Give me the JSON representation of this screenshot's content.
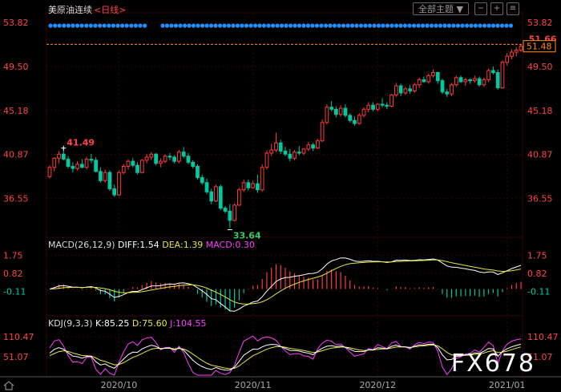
{
  "header": {
    "instrument": "美原油连续",
    "period": "<日线>",
    "theme_button": "全部主题 ▼",
    "brand_color": "#ff4444"
  },
  "indicators": {
    "macd": {
      "name": "MACD(26,12,9)",
      "diff": "DIFF:1.54",
      "dea": "DEA:1.39",
      "macd": "MACD:0.30"
    },
    "kdj": {
      "name": "KDJ(9,3,3)",
      "k": "K:85.25",
      "d": "D:75.60",
      "j": "J:104.55"
    }
  },
  "watermark": "FX678",
  "price_label": "51.48",
  "chart_data": {
    "type": "candlestick",
    "price_axis": {
      "ticks": [
        53.82,
        49.5,
        45.18,
        40.87,
        36.55
      ],
      "labels": [
        "53.82",
        "49.50",
        "45.18",
        "40.87",
        "36.55"
      ],
      "ylim": [
        32.9,
        54.6
      ]
    },
    "macd_axis": {
      "ticks": [
        1.75,
        0.82,
        -0.11
      ],
      "labels": [
        "1.75",
        "0.82",
        "-0.11"
      ],
      "ylim": [
        -1.3,
        2.1
      ]
    },
    "kdj_axis": {
      "ticks": [
        110.47,
        51.07
      ],
      "labels": [
        "110.47",
        "51.07"
      ],
      "ylim": [
        -5,
        140
      ]
    },
    "x_labels": [
      "2020/10",
      "2020/11",
      "2020/12",
      "2021/01"
    ],
    "x_label_index": [
      15,
      44,
      71,
      99
    ],
    "annotations": [
      {
        "text": "41.49",
        "index": 3,
        "value": 41.49
      },
      {
        "text": "33.64",
        "index": 39,
        "value": 33.64
      },
      {
        "text": "51.66",
        "index": 103,
        "value": 51.66
      }
    ],
    "last_close": 51.48,
    "max_line": 51.66,
    "colors": {
      "up": "#ff3b3b",
      "down": "#00c8a0",
      "diff": "#ffffff",
      "dea": "#e6e63c",
      "j": "#ff3cff"
    },
    "candles": [
      [
        38.7,
        39.8,
        38.5,
        39.6
      ],
      [
        39.6,
        40.6,
        39.2,
        40.5
      ],
      [
        40.5,
        41.2,
        40.0,
        40.9
      ],
      [
        40.9,
        41.49,
        40.3,
        40.4
      ],
      [
        40.4,
        40.7,
        39.5,
        39.7
      ],
      [
        39.7,
        40.1,
        39.1,
        39.5
      ],
      [
        39.5,
        40.2,
        39.3,
        39.9
      ],
      [
        39.9,
        40.4,
        39.5,
        39.6
      ],
      [
        39.6,
        40.6,
        39.4,
        40.4
      ],
      [
        40.4,
        40.9,
        40.0,
        40.3
      ],
      [
        40.3,
        40.6,
        39.1,
        39.2
      ],
      [
        39.2,
        39.6,
        38.1,
        38.3
      ],
      [
        38.3,
        39.4,
        38.1,
        39.1
      ],
      [
        39.1,
        39.3,
        37.3,
        37.5
      ],
      [
        37.5,
        37.9,
        36.7,
        36.9
      ],
      [
        36.9,
        39.3,
        36.8,
        39.1
      ],
      [
        39.1,
        39.9,
        38.9,
        39.7
      ],
      [
        39.7,
        40.4,
        39.4,
        40.2
      ],
      [
        40.2,
        40.5,
        39.6,
        39.8
      ],
      [
        39.8,
        40.1,
        38.9,
        39.1
      ],
      [
        39.1,
        40.4,
        39.0,
        40.3
      ],
      [
        40.3,
        40.9,
        40.0,
        40.6
      ],
      [
        40.6,
        41.1,
        40.3,
        40.9
      ],
      [
        40.9,
        41.0,
        39.8,
        40.0
      ],
      [
        40.0,
        40.5,
        39.6,
        40.2
      ],
      [
        40.2,
        40.9,
        40.0,
        40.7
      ],
      [
        40.7,
        41.0,
        40.3,
        40.6
      ],
      [
        40.6,
        40.8,
        40.0,
        40.2
      ],
      [
        40.2,
        41.3,
        40.0,
        41.1
      ],
      [
        41.1,
        41.6,
        40.5,
        40.7
      ],
      [
        40.7,
        41.0,
        39.9,
        40.1
      ],
      [
        40.1,
        40.3,
        39.5,
        39.7
      ],
      [
        39.7,
        39.9,
        38.4,
        38.6
      ],
      [
        38.6,
        38.9,
        37.9,
        38.1
      ],
      [
        38.1,
        38.5,
        37.0,
        37.2
      ],
      [
        37.2,
        37.5,
        36.0,
        36.3
      ],
      [
        36.3,
        37.9,
        36.2,
        37.7
      ],
      [
        37.7,
        37.9,
        35.4,
        35.6
      ],
      [
        35.6,
        35.8,
        35.1,
        35.3
      ],
      [
        35.3,
        36.0,
        33.64,
        34.4
      ],
      [
        34.4,
        36.1,
        34.3,
        35.9
      ],
      [
        35.9,
        37.6,
        35.8,
        37.4
      ],
      [
        37.4,
        38.4,
        37.2,
        38.1
      ],
      [
        38.1,
        38.4,
        37.3,
        37.6
      ],
      [
        37.6,
        38.3,
        37.5,
        38.0
      ],
      [
        38.0,
        38.9,
        37.1,
        37.4
      ],
      [
        37.4,
        39.9,
        37.2,
        39.6
      ],
      [
        39.6,
        41.3,
        39.4,
        41.0
      ],
      [
        41.0,
        41.9,
        40.7,
        41.3
      ],
      [
        41.3,
        43.0,
        41.1,
        42.0
      ],
      [
        42.0,
        42.3,
        40.9,
        41.2
      ],
      [
        41.2,
        41.6,
        40.7,
        40.9
      ],
      [
        40.9,
        41.4,
        40.2,
        40.5
      ],
      [
        40.5,
        41.3,
        40.3,
        41.1
      ],
      [
        41.1,
        41.7,
        40.8,
        41.0
      ],
      [
        41.0,
        41.5,
        40.8,
        41.4
      ],
      [
        41.4,
        42.1,
        41.2,
        41.8
      ],
      [
        41.8,
        42.0,
        41.2,
        41.5
      ],
      [
        41.5,
        42.4,
        41.4,
        42.2
      ],
      [
        42.2,
        44.3,
        42.1,
        44.0
      ],
      [
        44.0,
        45.8,
        43.8,
        45.5
      ],
      [
        45.5,
        46.1,
        45.1,
        45.3
      ],
      [
        45.3,
        45.6,
        44.5,
        44.8
      ],
      [
        44.8,
        45.7,
        44.6,
        45.4
      ],
      [
        45.4,
        45.8,
        44.5,
        44.7
      ],
      [
        44.7,
        44.9,
        44.0,
        44.2
      ],
      [
        44.2,
        44.6,
        43.7,
        43.9
      ],
      [
        43.9,
        44.9,
        43.8,
        44.7
      ],
      [
        44.7,
        45.5,
        44.5,
        45.3
      ],
      [
        45.3,
        46.0,
        45.0,
        45.7
      ],
      [
        45.7,
        46.0,
        45.1,
        45.3
      ],
      [
        45.3,
        45.9,
        45.1,
        45.8
      ],
      [
        45.8,
        46.4,
        45.5,
        45.7
      ],
      [
        45.7,
        46.0,
        45.3,
        45.6
      ],
      [
        45.6,
        46.8,
        45.5,
        46.7
      ],
      [
        46.7,
        47.9,
        46.5,
        47.6
      ],
      [
        47.6,
        47.8,
        46.6,
        46.9
      ],
      [
        46.9,
        47.5,
        46.7,
        47.3
      ],
      [
        47.3,
        47.7,
        46.8,
        47.1
      ],
      [
        47.1,
        47.9,
        46.9,
        47.7
      ],
      [
        47.7,
        48.4,
        47.4,
        48.2
      ],
      [
        48.2,
        48.5,
        47.9,
        48.0
      ],
      [
        48.0,
        48.8,
        47.8,
        48.6
      ],
      [
        48.6,
        49.2,
        48.4,
        48.9
      ],
      [
        48.9,
        49.0,
        47.8,
        48.1
      ],
      [
        48.1,
        48.3,
        46.8,
        47.0
      ],
      [
        47.0,
        47.3,
        46.5,
        46.8
      ],
      [
        46.8,
        47.9,
        46.6,
        47.7
      ],
      [
        47.7,
        48.6,
        47.5,
        48.4
      ],
      [
        48.4,
        48.6,
        47.9,
        48.0
      ],
      [
        48.0,
        48.4,
        47.6,
        48.2
      ],
      [
        48.2,
        48.3,
        47.8,
        48.1
      ],
      [
        48.1,
        48.6,
        47.9,
        48.3
      ],
      [
        48.3,
        48.5,
        47.5,
        47.7
      ],
      [
        47.7,
        48.4,
        47.5,
        48.2
      ],
      [
        48.2,
        49.3,
        48.0,
        49.1
      ],
      [
        49.1,
        49.5,
        48.7,
        48.9
      ],
      [
        48.9,
        49.2,
        47.2,
        47.4
      ],
      [
        47.4,
        50.1,
        47.3,
        49.9
      ],
      [
        49.9,
        50.8,
        49.6,
        50.5
      ],
      [
        50.5,
        51.2,
        50.2,
        50.9
      ],
      [
        50.9,
        51.4,
        50.5,
        51.1
      ],
      [
        51.1,
        51.66,
        50.9,
        51.48
      ]
    ]
  }
}
